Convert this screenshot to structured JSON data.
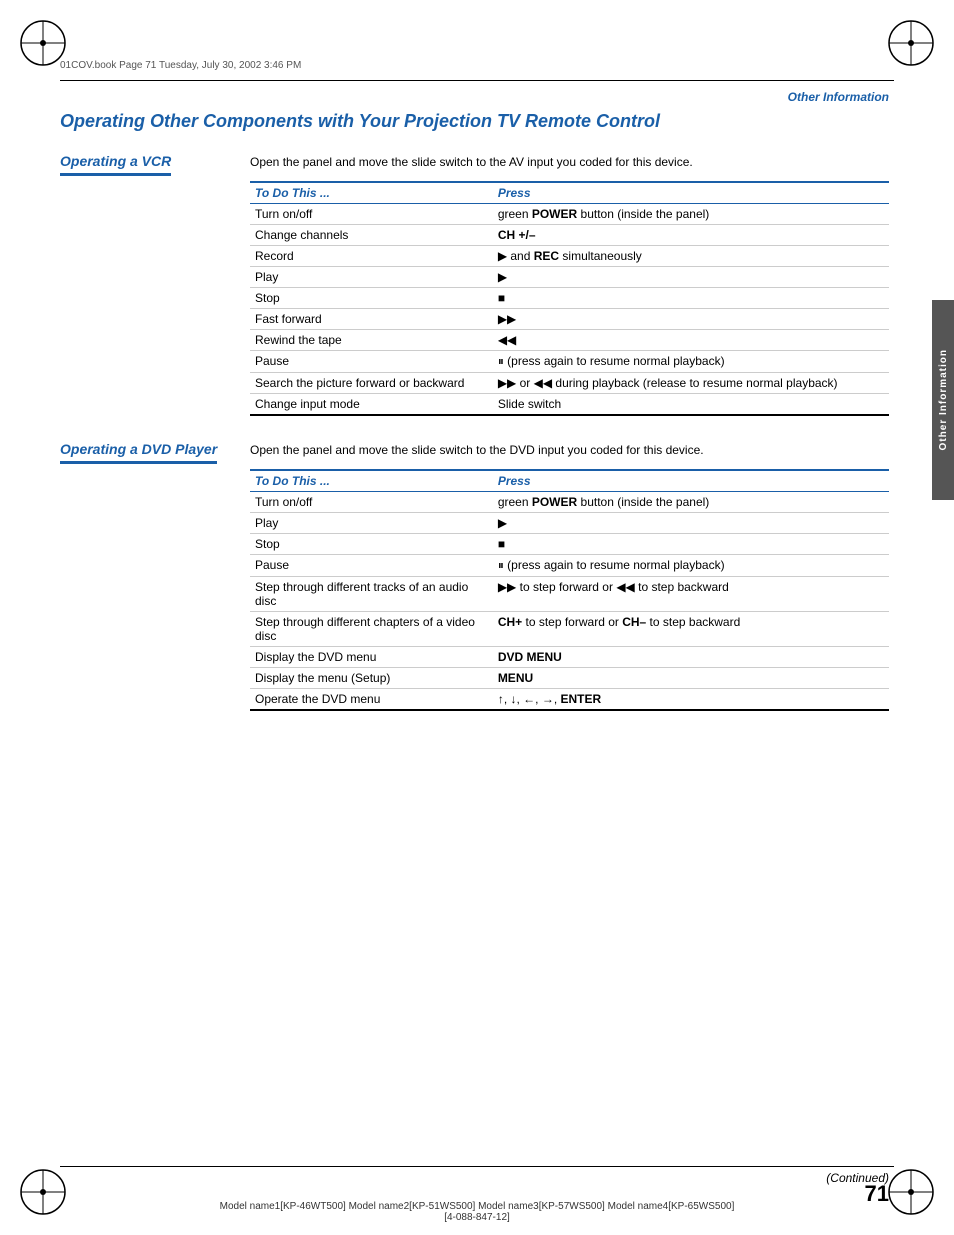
{
  "page": {
    "number": "71",
    "file_info": "01COV.book  Page 71  Tuesday, July 30, 2002  3:46 PM",
    "continued": "(Continued)",
    "bottom_model": "Model name1[KP-46WT500] Model name2[KP-51WS500] Model name3[KP-57WS500] Model name4[KP-65WS500]\n[4-088-847-12]"
  },
  "section_header": "Other Information",
  "side_tab": "Other Information",
  "title": "Operating Other Components with Your Projection TV Remote Control",
  "vcr": {
    "heading": "Operating a VCR",
    "description": "Open the panel and move the slide switch to the AV input you coded for this device.",
    "table": {
      "col1": "To Do This ...",
      "col2": "Press",
      "rows": [
        {
          "todo": "Turn on/off",
          "press": "green POWER button (inside the panel)"
        },
        {
          "todo": "Change channels",
          "press": "CH +/–"
        },
        {
          "todo": "Record",
          "press": "▶ and REC simultaneously"
        },
        {
          "todo": "Play",
          "press": "▶"
        },
        {
          "todo": "Stop",
          "press": "■"
        },
        {
          "todo": "Fast forward",
          "press": "▶▶"
        },
        {
          "todo": "Rewind the tape",
          "press": "◀◀"
        },
        {
          "todo": "Pause",
          "press": "⏸ (press again to resume normal playback)"
        },
        {
          "todo": "Search the picture forward or backward",
          "press": "▶▶ or ◀◀ during playback (release to resume normal playback)"
        },
        {
          "todo": "Change input mode",
          "press": "Slide switch"
        }
      ]
    }
  },
  "dvd": {
    "heading": "Operating a DVD Player",
    "description": "Open the panel and move the slide switch to the DVD input you coded for this device.",
    "table": {
      "col1": "To Do This ...",
      "col2": "Press",
      "rows": [
        {
          "todo": "Turn on/off",
          "press": "green POWER button (inside the panel)"
        },
        {
          "todo": "Play",
          "press": "▶"
        },
        {
          "todo": "Stop",
          "press": "■"
        },
        {
          "todo": "Pause",
          "press": "⏸ (press again to resume normal playback)"
        },
        {
          "todo": "Step through different tracks of an audio disc",
          "press": "▶▶ to step forward or ◀◀ to step backward"
        },
        {
          "todo": "Step through different chapters of a video disc",
          "press": "CH+ to step forward or CH– to step backward"
        },
        {
          "todo": "Display the DVD menu",
          "press": "DVD MENU"
        },
        {
          "todo": "Display the menu (Setup)",
          "press": "MENU"
        },
        {
          "todo": "Operate the DVD menu",
          "press": "↑, ↓, ←, →, ENTER"
        }
      ]
    }
  }
}
